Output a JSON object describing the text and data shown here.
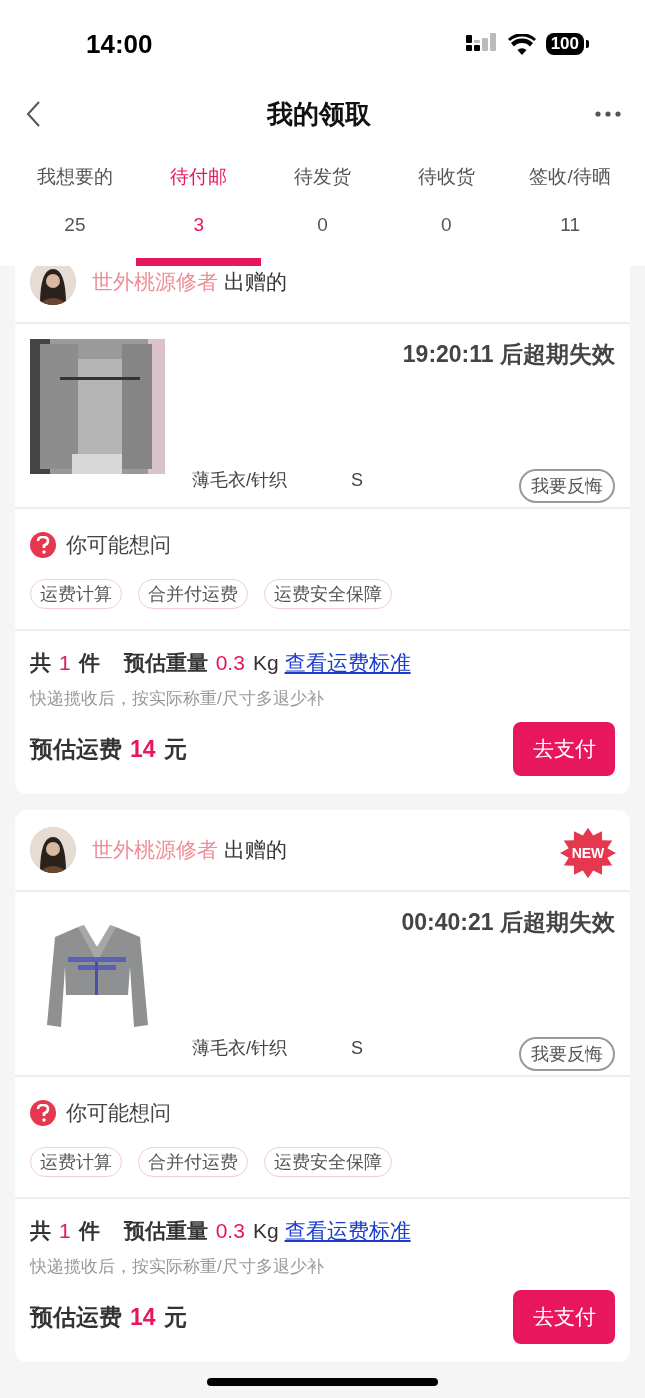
{
  "status_bar": {
    "time": "14:00",
    "battery": "100"
  },
  "nav": {
    "title": "我的领取"
  },
  "tabs": [
    {
      "label": "我想要的",
      "count": "25",
      "selected": false
    },
    {
      "label": "待付邮",
      "count": "3",
      "selected": true
    },
    {
      "label": "待发货",
      "count": "0",
      "selected": false
    },
    {
      "label": "待收货",
      "count": "0",
      "selected": false
    },
    {
      "label": "签收/待晒",
      "count": "11",
      "selected": false
    }
  ],
  "cards": [
    {
      "giver": "世外桃源修者",
      "giver_suffix": "出赠的",
      "countdown": "19:20:11 后超期失效",
      "category": "薄毛衣/针织",
      "size": "S",
      "regret_button": "我要反悔",
      "faq_title": "你可能想问",
      "faq_tags": [
        "运费计算",
        "合并付运费",
        "运费安全保障"
      ],
      "total_prefix": "共",
      "count": "1",
      "count_unit": "件",
      "weight_label": "预估重量",
      "weight": "0.3",
      "weight_unit": "Kg",
      "link": "查看运费标准",
      "note": "快递揽收后，按实际称重/尺寸多退少补",
      "fee_label": "预估运费",
      "fee": "14",
      "fee_unit": "元",
      "pay_button": "去支付"
    },
    {
      "giver": "世外桃源修者",
      "giver_suffix": "出赠的",
      "badge": "NEW",
      "countdown": "00:40:21 后超期失效",
      "category": "薄毛衣/针织",
      "size": "S",
      "regret_button": "我要反悔",
      "faq_title": "你可能想问",
      "faq_tags": [
        "运费计算",
        "合并付运费",
        "运费安全保障"
      ],
      "total_prefix": "共",
      "count": "1",
      "count_unit": "件",
      "weight_label": "预估重量",
      "weight": "0.3",
      "weight_unit": "Kg",
      "link": "查看运费标准",
      "note": "快递揽收后，按实际称重/尺寸多退少补",
      "fee_label": "预估运费",
      "fee": "14",
      "fee_unit": "元",
      "pay_button": "去支付"
    }
  ]
}
